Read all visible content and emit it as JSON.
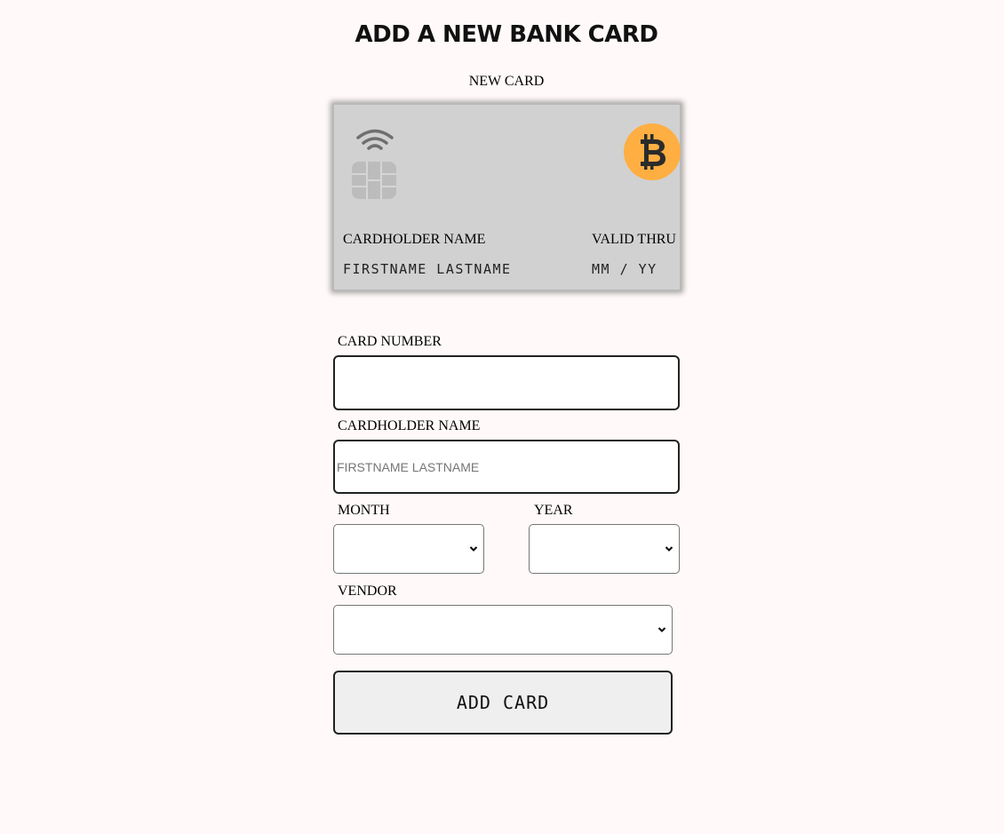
{
  "page": {
    "title": "ADD A NEW BANK CARD",
    "card_caption": "NEW CARD"
  },
  "card_preview": {
    "holder_label": "CARDHOLDER NAME",
    "holder_value": "FIRSTNAME LASTNAME",
    "valid_label": "VALID THRU",
    "valid_value": "MM / YY",
    "icons": [
      "wifi-icon",
      "chip-icon",
      "bitcoin-icon"
    ],
    "colors": {
      "card_background": "#d1d1d1",
      "bitcoin": "#ffae42"
    }
  },
  "form": {
    "card_number": {
      "label": "CARD NUMBER",
      "value": "",
      "placeholder": ""
    },
    "cardholder_name": {
      "label": "CARDHOLDER NAME",
      "value": "",
      "placeholder": "FIRSTNAME LASTNAME"
    },
    "month": {
      "label": "MONTH",
      "selected": ""
    },
    "year": {
      "label": "YEAR",
      "selected": ""
    },
    "vendor": {
      "label": "VENDOR",
      "selected": ""
    },
    "submit_label": "ADD CARD"
  }
}
